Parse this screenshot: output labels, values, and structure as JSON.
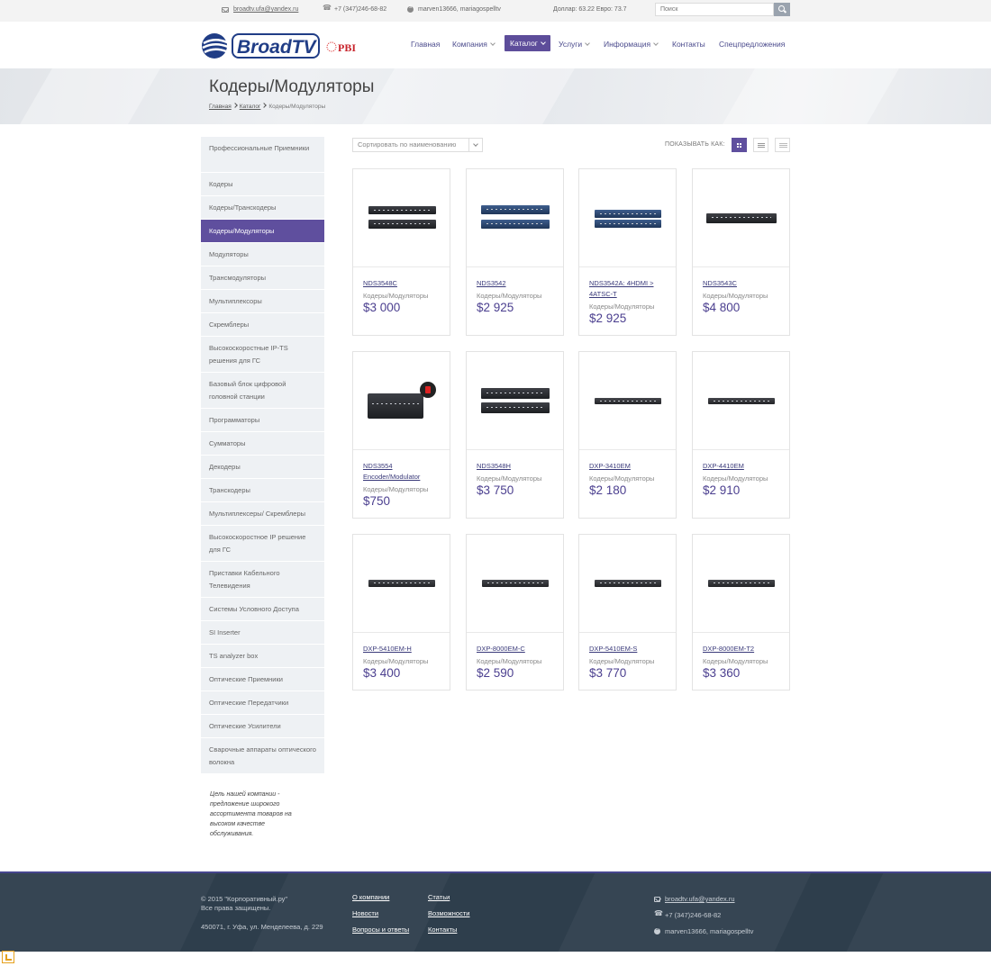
{
  "topbar": {
    "email": "broadtv.ufa@yandex.ru",
    "phone": "+7 (347)246-68-82",
    "skype": "marven13666, mariagospelltv",
    "rates": "Доллар: 63.22 Евро: 73.7",
    "search_placeholder": "Поиск"
  },
  "header": {
    "logo_text": "BroadTV",
    "logo_partner": "PBI",
    "nav": [
      {
        "label": "Главная"
      },
      {
        "label": "Компания"
      },
      {
        "label": "Каталог"
      },
      {
        "label": "Услуги"
      },
      {
        "label": "Информация"
      },
      {
        "label": "Контакты"
      },
      {
        "label": "Спецпредложения"
      }
    ]
  },
  "page": {
    "title": "Кодеры/Модуляторы",
    "breadcrumb": [
      "Главная",
      "Каталог",
      "Кодеры/Модуляторы"
    ]
  },
  "sidebar": {
    "items": [
      "Профессиональные Приемники",
      "Кодеры",
      "Кодеры/Транскодеры",
      "Кодеры/Модуляторы",
      "Модуляторы",
      "Трансмодуляторы",
      "Мультиплексоры",
      "Скремблеры",
      "Высокоскоростные IP-TS решения для ГС",
      "Базовый блок цифровой головной станции",
      "Программаторы",
      "Сумматоры",
      "Декодеры",
      "Транскодеры",
      "Мультиплексеры/ Скремблеры",
      "Высокоскоростное IP решение для ГС",
      "Приставки Кабельного Телевидения",
      "Системы Условного Доступа",
      "SI Inserter",
      "TS analyzer box",
      "Оптические Приемники",
      "Оптические Передатчики",
      "Оптические Усилители",
      "Сварочные аппараты оптического волокна"
    ],
    "note": "Цель нашей компании - предложение широкого ассортимента товаров на высоком качестве обслуживания."
  },
  "toolbar": {
    "sort_label": "Сортировать по наименованию",
    "view_label": "ПОКАЗЫВАТЬ КАК:"
  },
  "products": [
    {
      "name": "NDS3548C",
      "category": "Кодеры/Модуляторы",
      "price": "$3 000"
    },
    {
      "name": "NDS3542",
      "category": "Кодеры/Модуляторы",
      "price": "$2 925"
    },
    {
      "name": "NDS3542A: 4HDMI > 4ATSC-T",
      "category": "Кодеры/Модуляторы",
      "price": "$2 925"
    },
    {
      "name": "NDS3543C",
      "category": "Кодеры/Модуляторы",
      "price": "$4 800"
    },
    {
      "name": "NDS3554 Encoder/Modulator",
      "category": "Кодеры/Модуляторы",
      "price": "$750"
    },
    {
      "name": "NDS3548H",
      "category": "Кодеры/Модуляторы",
      "price": "$3 750"
    },
    {
      "name": "DXP-3410EM",
      "category": "Кодеры/Модуляторы",
      "price": "$2 180"
    },
    {
      "name": "DXP-4410EM",
      "category": "Кодеры/Модуляторы",
      "price": "$2 910"
    },
    {
      "name": "DXP-5410EM-H",
      "category": "Кодеры/Модуляторы",
      "price": "$3 400"
    },
    {
      "name": "DXP-8000EM-C",
      "category": "Кодеры/Модуляторы",
      "price": "$2 590"
    },
    {
      "name": "DXP-5410EM-S",
      "category": "Кодеры/Модуляторы",
      "price": "$3 770"
    },
    {
      "name": "DXP-8000EM-T2",
      "category": "Кодеры/Модуляторы",
      "price": "$3 360"
    }
  ],
  "footer": {
    "copyright_line1": "© 2015 \"Корпоративный.ру\"",
    "copyright_line2": "Все права защищены.",
    "address": "450071, г. Уфа, ул. Менделеева, д. 229",
    "links_col1": [
      "О компании",
      "Новости",
      "Вопросы и ответы"
    ],
    "links_col2": [
      "Статьи",
      "Возможности",
      "Контакты"
    ],
    "email": "broadtv.ufa@yandex.ru",
    "phone": "+7 (347)246-68-82",
    "skype": "marven13666, mariagospelltv"
  },
  "colors": {
    "accent": "#5f4f9e",
    "link": "#3a3a7a",
    "footer_bg": "#2e3e4c"
  }
}
